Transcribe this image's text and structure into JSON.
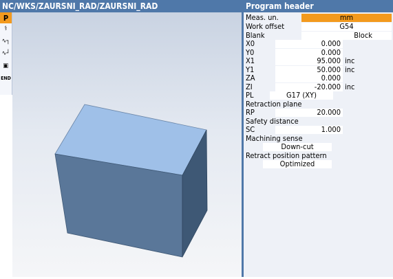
{
  "title_bar": {
    "path": "NC/WKS/ZAURSNI_RAD/ZAURSNI_RAD"
  },
  "panel": {
    "header": "Program header"
  },
  "toolbar": {
    "items": [
      {
        "label": "P",
        "icon": "program-header-icon",
        "active": true
      },
      {
        "label": "⚕",
        "icon": "tool-icon"
      },
      {
        "label": "∿┐",
        "icon": "contour-icon"
      },
      {
        "label": "∿┘",
        "icon": "contour-call-icon"
      },
      {
        "label": "▣",
        "icon": "cycle-icon"
      },
      {
        "label": "END",
        "icon": "end-icon"
      }
    ]
  },
  "params": {
    "meas_unit": {
      "label": "Meas. un.",
      "value": "mm"
    },
    "work_offset": {
      "label": "Work offset",
      "value": "G54"
    },
    "blank": {
      "label": "Blank",
      "value": "Block"
    },
    "x0": {
      "label": "X0",
      "value": "0.000"
    },
    "y0": {
      "label": "Y0",
      "value": "0.000"
    },
    "x1": {
      "label": "X1",
      "value": "95.000",
      "unit": "inc"
    },
    "y1": {
      "label": "Y1",
      "value": "50.000",
      "unit": "inc"
    },
    "za": {
      "label": "ZA",
      "value": "0.000"
    },
    "zi": {
      "label": "ZI",
      "value": "-20.000",
      "unit": "inc"
    },
    "pl": {
      "label": "PL",
      "value": "G17 (XY)"
    },
    "retraction_plane": {
      "label": "Retraction plane"
    },
    "rp": {
      "label": "RP",
      "value": "20.000"
    },
    "safety_distance": {
      "label": "Safety distance"
    },
    "sc": {
      "label": "SC",
      "value": "1.000"
    },
    "machining_sense": {
      "label": "Machining sense",
      "value": "Down-cut"
    },
    "retract_pattern": {
      "label": "Retract position pattern",
      "value": "Optimized"
    }
  },
  "colors": {
    "header_blue": "#4f78a9",
    "accent_orange": "#f39a1e",
    "block_top": "#9fc0e8",
    "block_front": "#5a7799",
    "block_side": "#3e5875"
  }
}
